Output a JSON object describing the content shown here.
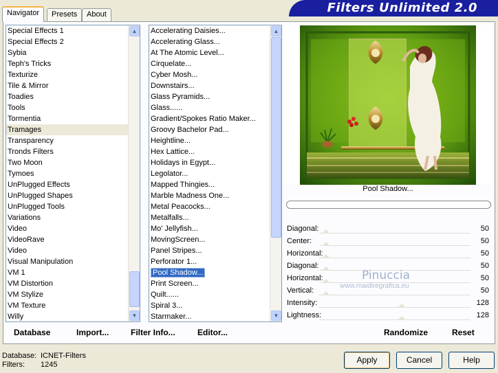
{
  "tabs": [
    {
      "label": "Navigator",
      "active": true
    },
    {
      "label": "Presets",
      "active": false
    },
    {
      "label": "About",
      "active": false
    }
  ],
  "banner_title": "Filters Unlimited 2.0",
  "categories": {
    "items": [
      "Special Effects 1",
      "Special Effects 2",
      "Sybia",
      "Teph's Tricks",
      "Texturize",
      "Tile & Mirror",
      "Toadies",
      "Tools",
      "Tormentia",
      "Tramages",
      "Transparency",
      "Tronds Filters",
      "Two Moon",
      "Tymoes",
      "UnPlugged Effects",
      "UnPlugged Shapes",
      "UnPlugged Tools",
      "Variations",
      "Video",
      "VideoRave",
      "Video",
      "Visual Manipulation",
      "VM 1",
      "VM Distortion",
      "VM Stylize",
      "VM Texture",
      "Willy"
    ],
    "selected_index": 9,
    "scroll_fraction": 0.85
  },
  "filters": {
    "items": [
      "Accelerating Daisies...",
      "Accelerating Glass...",
      "At The Atomic Level...",
      "Cirquelate...",
      "Cyber Mosh...",
      "Downstairs...",
      "Glass Pyramids...",
      "Glass......",
      "Gradient/Spokes Ratio Maker...",
      "Groovy Bachelor Pad...",
      "Heightline...",
      "Hex Lattice...",
      "Holidays in Egypt...",
      "Legolator...",
      "Mapped Thingies...",
      "Marble Madness One...",
      "Metal Peacocks...",
      "Metalfalls...",
      "Mo' Jellyfish...",
      "MovingScreen...",
      "Panel Stripes...",
      "Perforator 1...",
      "Pool Shadow...",
      "Print Screen...",
      "Quilt......",
      "Spiral 3...",
      "Starmaker..."
    ],
    "selected_index": 22,
    "scroll_fraction": 0.0
  },
  "preview": {
    "filter_name": "Pool Shadow...",
    "colors": {
      "green_dark": "#1f4a08",
      "green_light": "#9ccf1a",
      "gold": "#d6b45a"
    }
  },
  "params": [
    {
      "label": "Diagonal:",
      "value": "50",
      "fraction": 0.0
    },
    {
      "label": "Center:",
      "value": "50",
      "fraction": 0.0
    },
    {
      "label": "Horizontal:",
      "value": "50",
      "fraction": 0.0
    },
    {
      "label": "Diagonal:",
      "value": "50",
      "fraction": 0.0
    },
    {
      "label": "Horizontal:",
      "value": "50",
      "fraction": 0.0
    },
    {
      "label": "Vertical:",
      "value": "50",
      "fraction": 0.0
    },
    {
      "label": "Intensity:",
      "value": "128",
      "fraction": 0.5
    },
    {
      "label": "Lightness:",
      "value": "128",
      "fraction": 0.5
    }
  ],
  "watermark": {
    "name": "Pinuccia",
    "site": "www.maidiregrafica.eu"
  },
  "bottom_buttons": {
    "database": "Database",
    "import": "Import...",
    "filter_info": "Filter Info...",
    "editor": "Editor...",
    "randomize": "Randomize",
    "reset": "Reset"
  },
  "status": {
    "database_label": "Database:",
    "database_value": "ICNET-Filters",
    "filters_label": "Filters:",
    "filters_value": "1245"
  },
  "dialog_buttons": {
    "apply": "Apply",
    "cancel": "Cancel",
    "help": "Help"
  }
}
